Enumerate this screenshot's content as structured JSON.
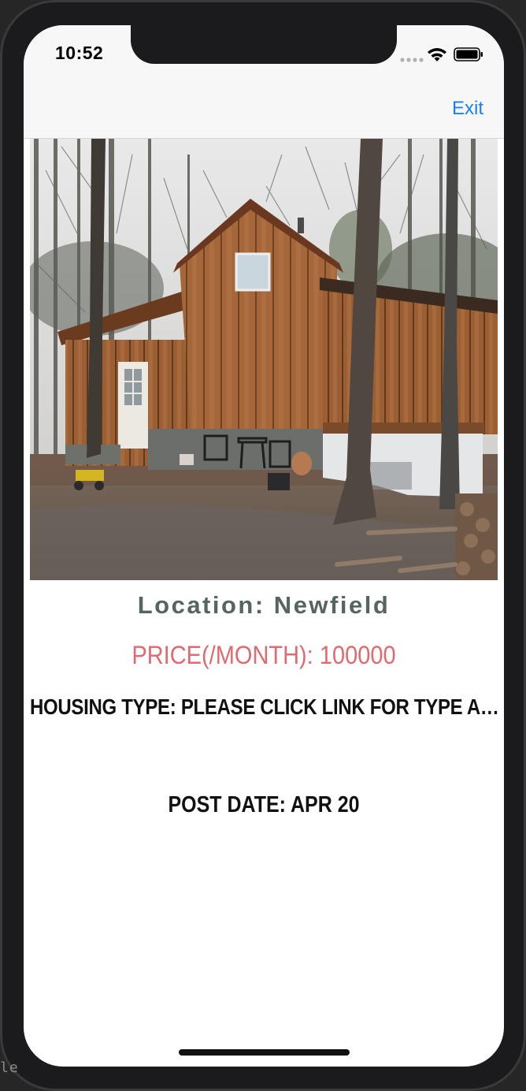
{
  "status_bar": {
    "time": "10:52",
    "icons": [
      "signal-icon",
      "wifi-icon",
      "battery-icon"
    ]
  },
  "nav": {
    "exit_label": "Exit"
  },
  "listing": {
    "photo": "house-photo",
    "location": "Location: Newfield",
    "price": "PRICE(/MONTH): 100000",
    "housing_type": "HOUSING TYPE: PLEASE CLICK LINK FOR TYPE AND SIZE INFO",
    "post_date": "POST DATE: APR 20"
  },
  "background": {
    "partial_text": "le"
  },
  "colors": {
    "accent": "#1a82f0",
    "location": "#55665c",
    "price": "#e06a70"
  }
}
